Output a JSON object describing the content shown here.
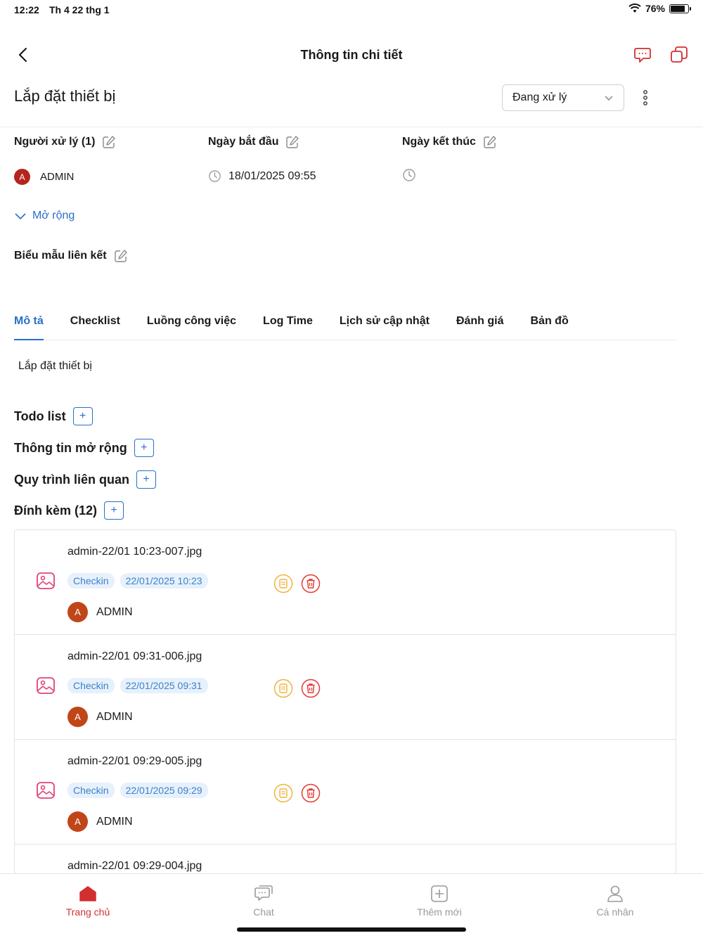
{
  "status_bar": {
    "time": "12:22",
    "date": "Th 4 22 thg 1",
    "battery": "76%"
  },
  "nav": {
    "title": "Thông tin chi tiết"
  },
  "task": {
    "title": "Lắp đặt thiết bị",
    "status": "Đang xử lý"
  },
  "fields": {
    "assignee_label": "Người xử lý (1)",
    "start_label": "Ngày bắt đầu",
    "end_label": "Ngày kết thúc",
    "assignee_initial": "A",
    "assignee_name": "ADMIN",
    "start_value": "18/01/2025 09:55",
    "end_value": ""
  },
  "expand_label": "Mở rộng",
  "linked_form_label": "Biểu mẫu liên kết",
  "tabs": [
    {
      "label": "Mô tả",
      "active": true
    },
    {
      "label": "Checklist"
    },
    {
      "label": "Luồng công việc"
    },
    {
      "label": "Log Time"
    },
    {
      "label": "Lịch sử cập nhật"
    },
    {
      "label": "Đánh giá"
    },
    {
      "label": "Bản đồ"
    }
  ],
  "description": "Lắp đặt thiết bị",
  "sections": {
    "todo": "Todo list",
    "extra_info": "Thông tin mở rộng",
    "related_process": "Quy trình liên quan",
    "attachments": "Đính kèm (12)"
  },
  "attachments": [
    {
      "file_name": "admin-22/01 10:23-007.jpg",
      "tag": "Checkin",
      "datetime": "22/01/2025 10:23",
      "owner_initial": "A",
      "owner": "ADMIN"
    },
    {
      "file_name": "admin-22/01 09:31-006.jpg",
      "tag": "Checkin",
      "datetime": "22/01/2025 09:31",
      "owner_initial": "A",
      "owner": "ADMIN"
    },
    {
      "file_name": "admin-22/01 09:29-005.jpg",
      "tag": "Checkin",
      "datetime": "22/01/2025 09:29",
      "owner_initial": "A",
      "owner": "ADMIN"
    },
    {
      "file_name": "admin-22/01 09:29-004.jpg"
    }
  ],
  "tab_bar": [
    {
      "label": "Trang chủ",
      "icon": "home-icon",
      "active": true
    },
    {
      "label": "Chat",
      "icon": "chat-icon"
    },
    {
      "label": "Thêm mới",
      "icon": "add-icon"
    },
    {
      "label": "Cá nhân",
      "icon": "user-icon"
    }
  ],
  "colors": {
    "accent": "#2a6fc9",
    "brand_red": "#d32f2f",
    "tag_bg": "#e7f1fc",
    "note_orange": "#f0b43c"
  }
}
